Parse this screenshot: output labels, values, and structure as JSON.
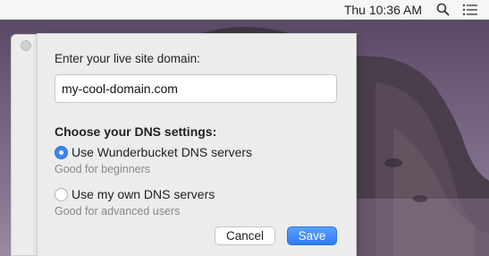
{
  "menubar": {
    "clock": "Thu 10:36 AM",
    "search_icon": "search-icon",
    "menu_icon": "list-icon"
  },
  "dialog": {
    "domain_label": "Enter your live site domain:",
    "domain_value": "my-cool-domain.com",
    "dns_title": "Choose your DNS settings:",
    "options": [
      {
        "label": "Use Wunderbucket DNS servers",
        "hint": "Good for beginners",
        "selected": true
      },
      {
        "label": "Use my own DNS servers",
        "hint": "Good for advanced users",
        "selected": false
      }
    ],
    "cancel_label": "Cancel",
    "save_label": "Save"
  },
  "colors": {
    "accent": "#3a82f7",
    "dialog_bg": "#ececec"
  }
}
